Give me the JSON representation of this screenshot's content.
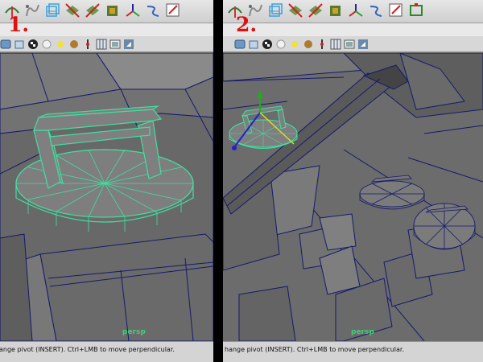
{
  "panels": [
    {
      "step": "1.",
      "camera": "persp",
      "help_text": "ange pivot (INSERT).  Ctrl+LMB to move perpendicular."
    },
    {
      "step": "2.",
      "camera": "persp",
      "help_text": "hange pivot (INSERT).  Ctrl+LMB to move perpendicular."
    }
  ],
  "colors": {
    "wireframe_selected": "#3fe0a0",
    "wireframe_unselected": "#141a6e",
    "surface": "#767676",
    "step_label": "#e01010"
  },
  "shelf_icons": [
    "soft-body-icon",
    "nurbs-curve-icon",
    "lattice-box-icon",
    "split-poly-icon",
    "split-poly-2-icon",
    "texture-cube-icon",
    "move-axis-icon",
    "bend-deformer-icon",
    "pencil-edit-icon",
    "frame-icon"
  ],
  "panel_toolbar_icons": [
    "camera-icon",
    "camera-2-icon",
    "checker-icon",
    "sphere-icon",
    "light-icon",
    "shaded-sphere-icon",
    "pivot-icon",
    "grid-icon",
    "film-icon",
    "share-icon"
  ]
}
